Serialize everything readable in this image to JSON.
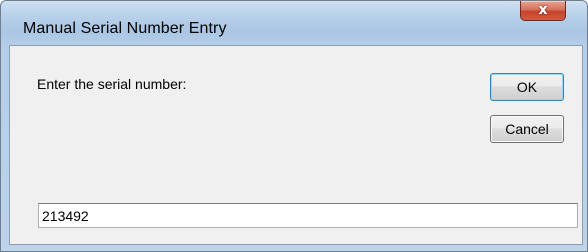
{
  "window": {
    "title": "Manual Serial Number Entry",
    "close_glyph": "x",
    "close_icon": "close-icon"
  },
  "dialog": {
    "prompt": "Enter the serial number:",
    "ok_label": "OK",
    "cancel_label": "Cancel",
    "serial_value": "213492"
  },
  "colors": {
    "titlebar": "#b9d1ea",
    "close_button": "#c7432c",
    "client_background": "#f0f0f0",
    "default_button_border": "#3c7fb1"
  }
}
